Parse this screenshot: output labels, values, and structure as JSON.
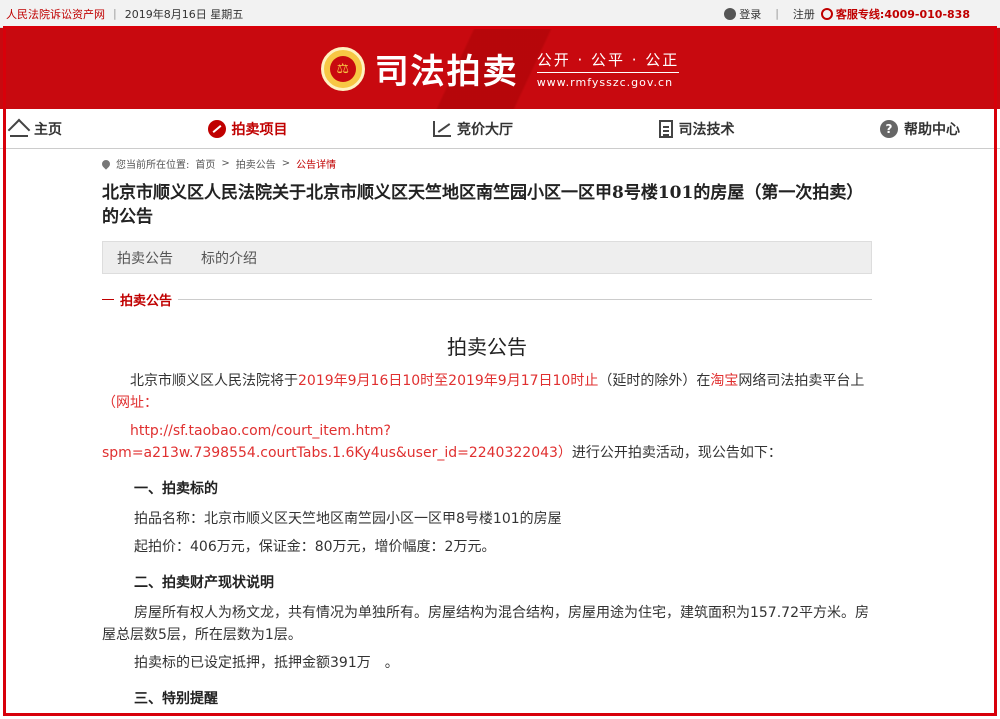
{
  "topbar": {
    "site_name": "人民法院诉讼资产网",
    "date": "2019年8月16日  星期五",
    "login": "登录",
    "register": "注册",
    "hotline": "客服专线:4009-010-838"
  },
  "banner": {
    "brand": "司法拍卖",
    "slogan": "公开 · 公平 · 公正",
    "url": "www.rmfysszc.gov.cn"
  },
  "nav": {
    "home": "主页",
    "auction_items": "拍卖项目",
    "bidding_hall": "竞价大厅",
    "judicial_tech": "司法技术",
    "help_center": "帮助中心"
  },
  "breadcrumb": {
    "prefix": "您当前所在位置:",
    "home": "首页",
    "announcements": "拍卖公告",
    "current": "公告详情",
    "separator": ">"
  },
  "page_title": "北京市顺义区人民法院关于北京市顺义区天竺地区南竺园小区一区甲8号楼101的房屋（第一次拍卖）的公告",
  "tabs": [
    "拍卖公告",
    "标的介绍"
  ],
  "section_label": "拍卖公告",
  "notice": {
    "heading": "拍卖公告",
    "intro_1": "北京市顺义区人民法院将于",
    "time_range": "2019年9月16日10时至2019年9月17日10时止",
    "intro_2": "（延时的除外）在",
    "platform": "淘宝",
    "intro_3": "网络司法拍卖平台上",
    "website_label": "（网址：",
    "url_1": "http://sf.taobao.com/court_item.htm?",
    "url_2": "spm=a213w.7398554.courtTabs.1.6Ky4us&user_id=2240322043",
    "url_close": "）",
    "intro_4": "进行公开拍卖活动，现公告如下：",
    "section1_title": "一、拍卖标的",
    "item_name": "拍品名称：北京市顺义区天竺地区南竺园小区一区甲8号楼101的房屋",
    "price_info": "起拍价：406万元，保证金：80万元，增价幅度：2万元。",
    "section2_title": "二、拍卖财产现状说明",
    "status_desc": "房屋所有权人为杨文龙，共有情况为单独所有。房屋结构为混合结构，房屋用途为住宅，建筑面积为157.72平方米。房屋总层数5层，所在层数为1层。",
    "mortgage": "拍卖标的已设定抵押，抵押金额391万　。",
    "section3_title": "三、特别提醒"
  }
}
